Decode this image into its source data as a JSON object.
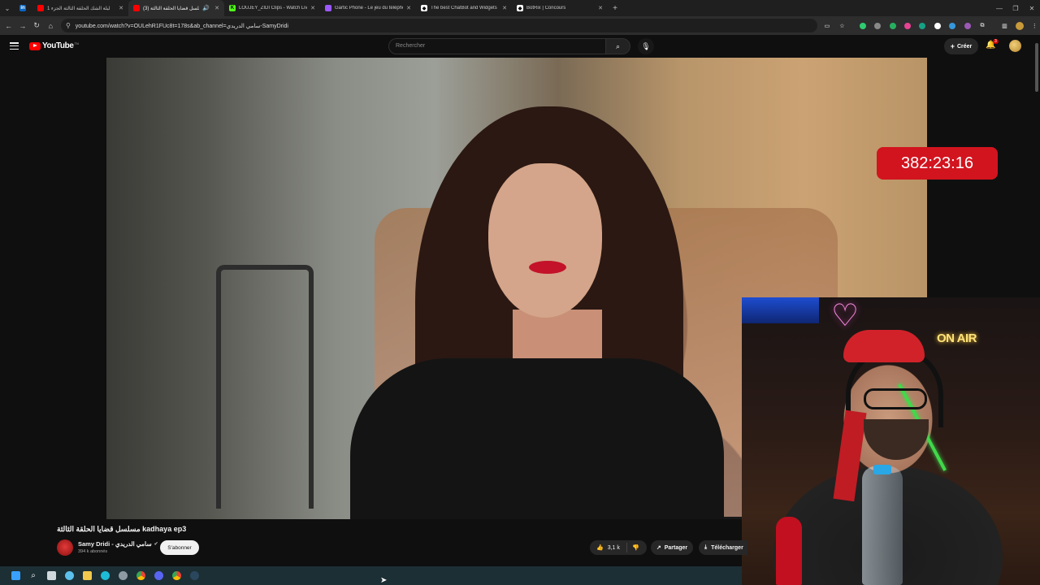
{
  "browser": {
    "tabs": [
      {
        "title": "ليلة الشك الحلقة الثالثة الجزء 1",
        "favicon": "youtube-icon",
        "color": "#ff0000",
        "active": false
      },
      {
        "title": "(3) مسلسل قضايا الحلقة الثالثة",
        "favicon": "youtube-icon",
        "color": "#ff0000",
        "active": true
      },
      {
        "title": "LOUJEY_ZIDI Clips - Watch Live",
        "favicon": "kick-icon",
        "color": "#53fc18",
        "active": false
      },
      {
        "title": "Gartic Phone - Le jeu du télépho",
        "favicon": "gartic-icon",
        "color": "#9b59ff",
        "active": false
      },
      {
        "title": "The best ChatBot and Widgets",
        "favicon": "botrix-icon",
        "color": "#ffffff",
        "active": false
      },
      {
        "title": "BotRix | Concours",
        "favicon": "botrix-icon",
        "color": "#ffffff",
        "active": false
      }
    ],
    "url": "youtube.com/watch?v=OULehR1FUc8t=178s&ab_channel=سامي الدريدي-SamyDridi"
  },
  "youtube": {
    "logo_text": "YouTube",
    "logo_suffix": "TN",
    "search_placeholder": "Rechercher",
    "create_label": "Créer",
    "notification_count": "3"
  },
  "video": {
    "title": "مسلسل قضايا الحلقة الثالثة kadhaya ep3",
    "timer": "382:23:16",
    "channel_name": "Samy Dridi - سامي الدريدي",
    "subscribers": "394 k abonnés",
    "subscribe_label": "S'abonner",
    "likes": "3,1 k",
    "share_label": "Partager",
    "download_label": "Télécharger"
  },
  "webcam": {
    "sign_text": "ON AIR"
  },
  "colors": {
    "youtube_red": "#ff0000",
    "timer_bg": "#d2141f",
    "taskbar": "#1c2f35"
  }
}
